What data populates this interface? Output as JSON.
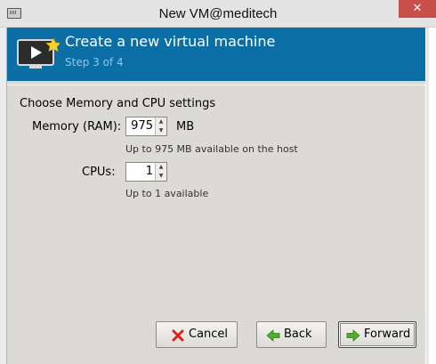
{
  "window": {
    "title": "New VM@meditech",
    "close_glyph": "✕",
    "app_icon": "virt-manager-icon"
  },
  "header": {
    "title": "Create a new virtual machine",
    "step": "Step 3 of 4",
    "icon": "monitor-play-icon",
    "bg_color": "#0b6ea5"
  },
  "content": {
    "section_title": "Choose Memory and CPU settings",
    "memory": {
      "label": "Memory (RAM):",
      "value": "975",
      "unit": "MB",
      "hint": "Up to 975 MB available on the host"
    },
    "cpus": {
      "label": "CPUs:",
      "value": "1",
      "hint": "Up to 1 available"
    }
  },
  "buttons": {
    "cancel": "Cancel",
    "back": "Back",
    "forward": "Forward"
  }
}
